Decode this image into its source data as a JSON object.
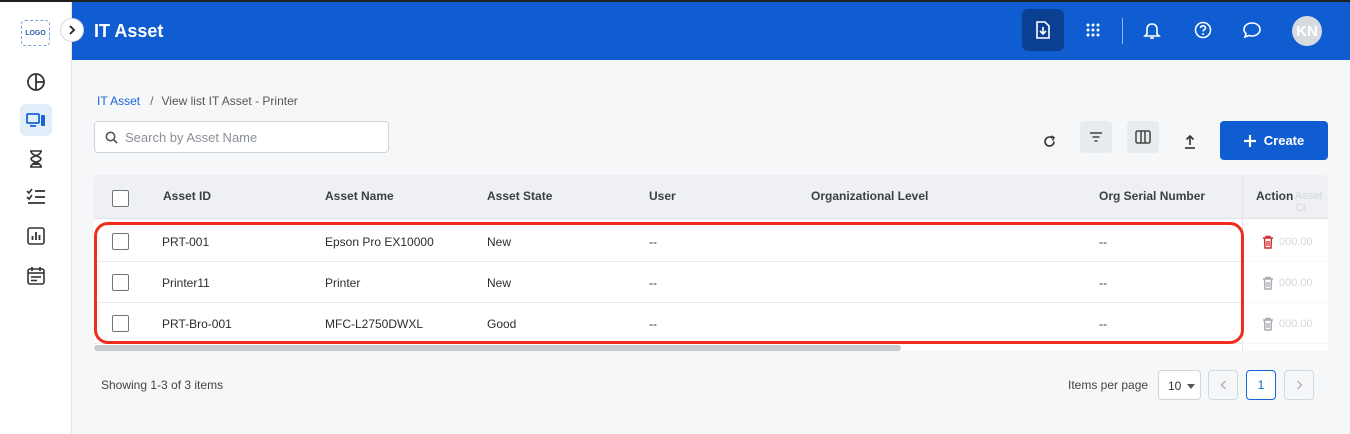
{
  "app": {
    "title": "IT Asset",
    "logo_text": "LOGO",
    "avatar_initials": "KN"
  },
  "sidebar": {
    "items": [
      {
        "icon": "pie-chart-icon"
      },
      {
        "icon": "devices-icon",
        "active": true
      },
      {
        "icon": "hourglass-icon"
      },
      {
        "icon": "checklist-icon"
      },
      {
        "icon": "bar-chart-icon"
      },
      {
        "icon": "calendar-icon"
      }
    ]
  },
  "header": {
    "icons": [
      "download-icon",
      "apps-grid-icon",
      "bell-icon",
      "help-icon",
      "chat-icon"
    ]
  },
  "breadcrumb": {
    "root": "IT Asset",
    "sep": "/",
    "current": "View list IT Asset - Printer"
  },
  "search": {
    "placeholder": "Search by Asset Name",
    "value": ""
  },
  "toolbar": {
    "icons": [
      "refresh-icon",
      "filter-icon",
      "columns-icon",
      "upload-icon"
    ],
    "create_label": "Create"
  },
  "table": {
    "columns": [
      "Asset ID",
      "Asset Name",
      "Asset State",
      "User",
      "Organizational Level",
      "Org Serial Number",
      "Action"
    ],
    "ghost_header": "Asset Cl",
    "ghost_value": "000.00",
    "rows": [
      {
        "asset_id": "PRT-001",
        "asset_name": "Epson Pro EX10000",
        "state": "New",
        "user": "--",
        "org_level": "",
        "org_serial": "--"
      },
      {
        "asset_id": "Printer11",
        "asset_name": "Printer",
        "state": "New",
        "user": "--",
        "org_level": "",
        "org_serial": "--"
      },
      {
        "asset_id": "PRT-Bro-001",
        "asset_name": "MFC-L2750DWXL",
        "state": "Good",
        "user": "--",
        "org_level": "",
        "org_serial": "--"
      }
    ]
  },
  "footer": {
    "showing": "Showing 1-3 of 3 items",
    "items_per_page_label": "Items per page",
    "items_per_page": "10",
    "current_page": "1"
  },
  "colors": {
    "primary": "#0f5dd0",
    "header_dark": "#0a3f91",
    "delete": "#d32f2f",
    "highlight": "#f02c1c"
  }
}
